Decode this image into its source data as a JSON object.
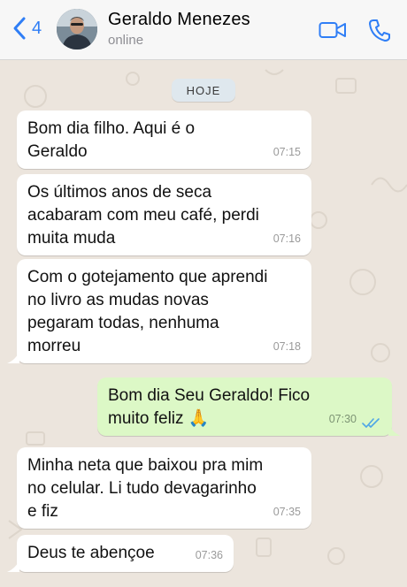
{
  "header": {
    "back_count": "4",
    "contact_name": "Geraldo Menezes",
    "status": "online"
  },
  "chat": {
    "date_chip": "HOJE",
    "messages": [
      {
        "direction": "in",
        "lines": [
          "Bom dia filho. Aqui é o",
          "Geraldo"
        ],
        "time": "07:15"
      },
      {
        "direction": "in",
        "lines": [
          "Os últimos anos de seca",
          "acabaram com meu café, perdi",
          "muita muda"
        ],
        "time": "07:16"
      },
      {
        "direction": "in",
        "lines": [
          "Com o gotejamento que aprendi",
          "no livro as mudas novas",
          "pegaram todas, nenhuma",
          "morreu"
        ],
        "time": "07:18"
      },
      {
        "direction": "out",
        "lines": [
          "Bom dia Seu Geraldo! Fico",
          "muito feliz 🙏"
        ],
        "time": "07:30",
        "read": true
      },
      {
        "direction": "in",
        "lines": [
          "Minha neta que baixou pra mim",
          "no celular. Li tudo devagarinho",
          "e fiz"
        ],
        "time": "07:35"
      },
      {
        "direction": "in",
        "lines": [
          "Deus te abençoe"
        ],
        "time": "07:36"
      }
    ]
  },
  "colors": {
    "accent": "#2f7ef6",
    "incoming_bubble": "#ffffff",
    "outgoing_bubble": "#dcf8c6",
    "read_ticks": "#4fa6e6",
    "wallpaper": "#ece5dd"
  },
  "icons": [
    "chevron-left-icon",
    "video-call-icon",
    "phone-icon",
    "double-check-icon"
  ]
}
